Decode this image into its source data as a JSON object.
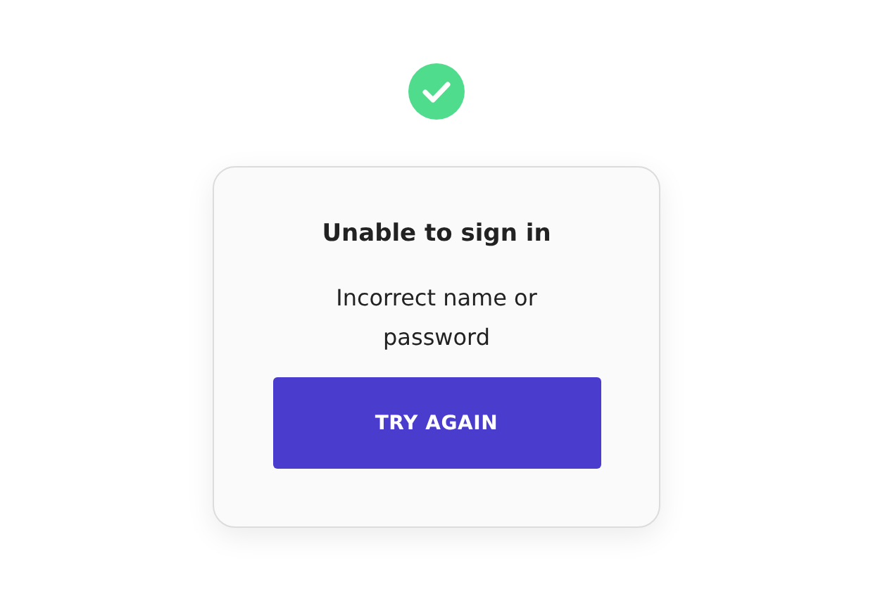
{
  "dialog": {
    "title": "Unable to sign in",
    "message": "Incorrect name or password",
    "button": "TRY AGAIN"
  }
}
